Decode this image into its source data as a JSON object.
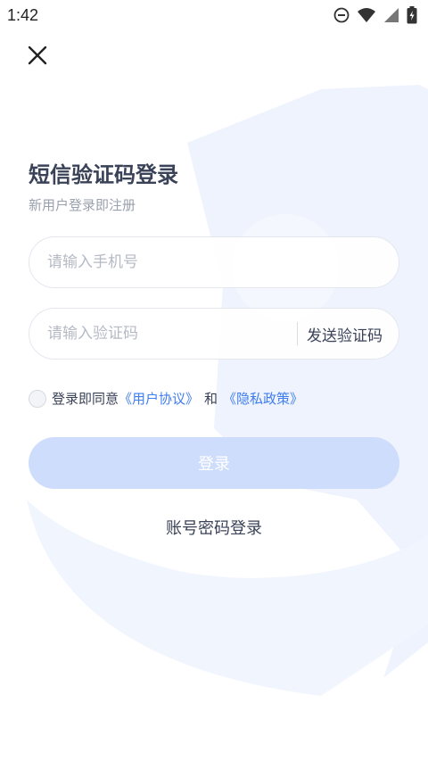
{
  "status_bar": {
    "time": "1:42",
    "icons": [
      "do-not-disturb-icon",
      "wifi-icon",
      "signal-icon",
      "battery-charging-icon"
    ]
  },
  "header": {
    "close_icon": "close-icon"
  },
  "main": {
    "title": "短信验证码登录",
    "subtitle": "新用户登录即注册",
    "phone_input": {
      "placeholder": "请输入手机号",
      "value": ""
    },
    "code_input": {
      "placeholder": "请输入验证码",
      "value": ""
    },
    "send_code_label": "发送验证码",
    "agreement": {
      "prefix": "登录即同意",
      "user_agreement": "《用户协议》",
      "and": "和",
      "privacy_policy": "《隐私政策》",
      "checked": false
    },
    "login_label": "登录",
    "password_login_label": "账号密码登录"
  },
  "colors": {
    "title": "#3a4257",
    "link": "#3f7df0",
    "login_button": "#cfddfc",
    "decor": "#eef3fd"
  }
}
